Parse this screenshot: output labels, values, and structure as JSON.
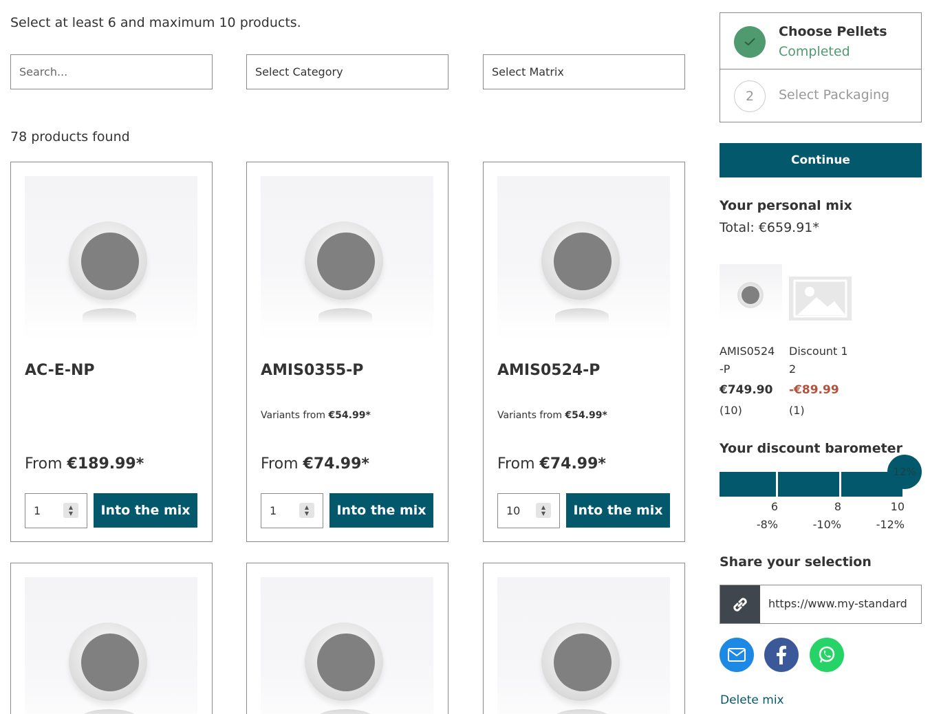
{
  "instruction": "Select at least 6 and maximum 10 products.",
  "filters": {
    "search_placeholder": "Search...",
    "category_label": "Select Category",
    "matrix_label": "Select Matrix"
  },
  "results_count": "78 products found",
  "products": [
    {
      "name": "AC-E-NP",
      "variants_prefix": "",
      "variants_price": "",
      "price_prefix": "From",
      "price": "€189.99*",
      "qty": "1",
      "button": "Into the mix"
    },
    {
      "name": "AMIS0355-P",
      "variants_prefix": "Variants from",
      "variants_price": "€54.99*",
      "price_prefix": "From",
      "price": "€74.99*",
      "qty": "1",
      "button": "Into the mix"
    },
    {
      "name": "AMIS0524-P",
      "variants_prefix": "Variants from",
      "variants_price": "€54.99*",
      "price_prefix": "From",
      "price": "€74.99*",
      "qty": "10",
      "button": "Into the mix"
    }
  ],
  "steps": {
    "step1_title": "Choose Pellets",
    "step1_status": "Completed",
    "step2_number": "2",
    "step2_title": "Select Packaging"
  },
  "continue_label": "Continue",
  "mix": {
    "title": "Your personal mix",
    "total": "Total: €659.91*",
    "items": [
      {
        "name_line1": "AMIS0524",
        "name_line2": "-P",
        "amount": "€749.90",
        "count": "(10)"
      },
      {
        "name_line1": "Discount 1",
        "name_line2": "2",
        "amount": "-€89.99",
        "count": "(1)"
      }
    ]
  },
  "barometer": {
    "title": "Your discount barometer",
    "current_badge": "12%",
    "levels": [
      {
        "qty": "6",
        "discount": "-8%"
      },
      {
        "qty": "8",
        "discount": "-10%"
      },
      {
        "qty": "10",
        "discount": "-12%"
      }
    ]
  },
  "share": {
    "title": "Share your selection",
    "url": "https://www.my-standard"
  },
  "icons": {
    "check": "check-icon",
    "link": "link-icon",
    "email": "email-icon",
    "facebook": "facebook-icon",
    "whatsapp": "whatsapp-icon"
  },
  "colors": {
    "primary": "#03596b",
    "success": "#4f9a6f",
    "discount": "#b5513b",
    "email": "#1e88e5",
    "facebook": "#3b5998",
    "whatsapp": "#25d366"
  },
  "delete_label": "Delete mix"
}
